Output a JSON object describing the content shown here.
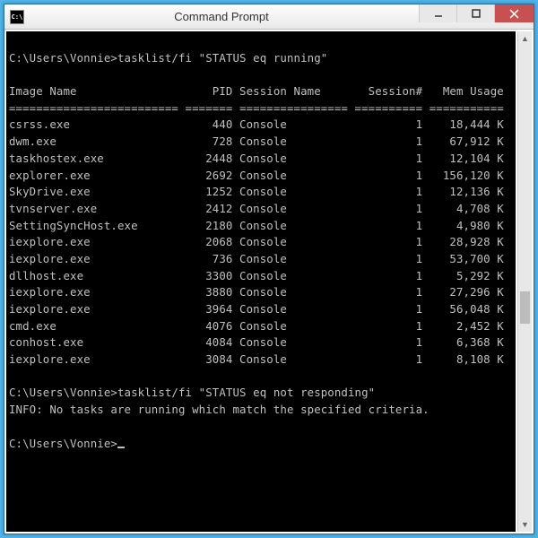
{
  "window": {
    "title": "Command Prompt",
    "icon_glyph": "C:\\"
  },
  "prompt_path": "C:\\Users\\Vonnie>",
  "command1": "tasklist/fi \"STATUS eq running\"",
  "command2": "tasklist/fi \"STATUS eq not responding\"",
  "info_line": "INFO: No tasks are running which match the specified criteria.",
  "headers": {
    "image_name": "Image Name",
    "pid": "PID",
    "session_name": "Session Name",
    "session_num": "Session#",
    "mem_usage": "Mem Usage"
  },
  "processes": [
    {
      "name": "csrss.exe",
      "pid": 440,
      "session": "Console",
      "snum": 1,
      "mem": "18,444 K"
    },
    {
      "name": "dwm.exe",
      "pid": 728,
      "session": "Console",
      "snum": 1,
      "mem": "67,912 K"
    },
    {
      "name": "taskhostex.exe",
      "pid": 2448,
      "session": "Console",
      "snum": 1,
      "mem": "12,104 K"
    },
    {
      "name": "explorer.exe",
      "pid": 2692,
      "session": "Console",
      "snum": 1,
      "mem": "156,120 K"
    },
    {
      "name": "SkyDrive.exe",
      "pid": 1252,
      "session": "Console",
      "snum": 1,
      "mem": "12,136 K"
    },
    {
      "name": "tvnserver.exe",
      "pid": 2412,
      "session": "Console",
      "snum": 1,
      "mem": "4,708 K"
    },
    {
      "name": "SettingSyncHost.exe",
      "pid": 2180,
      "session": "Console",
      "snum": 1,
      "mem": "4,980 K"
    },
    {
      "name": "iexplore.exe",
      "pid": 2068,
      "session": "Console",
      "snum": 1,
      "mem": "28,928 K"
    },
    {
      "name": "iexplore.exe",
      "pid": 736,
      "session": "Console",
      "snum": 1,
      "mem": "53,700 K"
    },
    {
      "name": "dllhost.exe",
      "pid": 3300,
      "session": "Console",
      "snum": 1,
      "mem": "5,292 K"
    },
    {
      "name": "iexplore.exe",
      "pid": 3880,
      "session": "Console",
      "snum": 1,
      "mem": "27,296 K"
    },
    {
      "name": "iexplore.exe",
      "pid": 3964,
      "session": "Console",
      "snum": 1,
      "mem": "56,048 K"
    },
    {
      "name": "cmd.exe",
      "pid": 4076,
      "session": "Console",
      "snum": 1,
      "mem": "2,452 K"
    },
    {
      "name": "conhost.exe",
      "pid": 4084,
      "session": "Console",
      "snum": 1,
      "mem": "6,368 K"
    },
    {
      "name": "iexplore.exe",
      "pid": 3084,
      "session": "Console",
      "snum": 1,
      "mem": "8,108 K"
    }
  ]
}
